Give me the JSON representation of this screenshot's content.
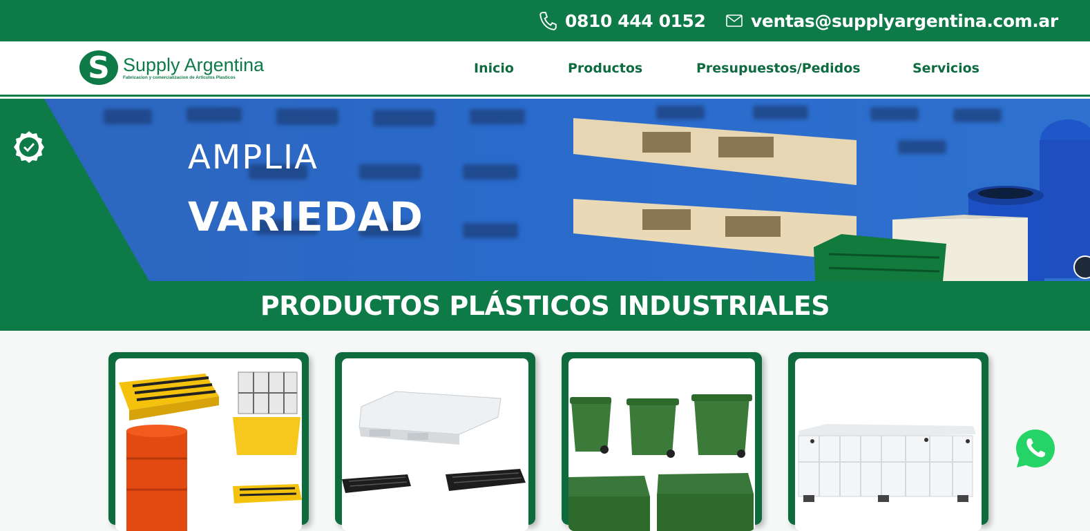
{
  "topbar": {
    "phone": "0810 444 0152",
    "email": "ventas@supplyargentina.com.ar",
    "phone_icon": "phone-icon",
    "email_icon": "envelope-icon"
  },
  "header": {
    "logo_name": "Supply Argentina",
    "logo_tagline": "Fabricacion y comercializacion de Articulos Plasticos",
    "nav": [
      "Inicio",
      "Productos",
      "Presupuestos/Pedidos",
      "Servicios"
    ]
  },
  "hero": {
    "line1": "AMPLIA",
    "line2": "VARIEDAD",
    "badge_icon": "check-badge-icon"
  },
  "section": {
    "title": "PRODUCTOS PLÁSTICOS INDUSTRIALES"
  },
  "products": [
    {
      "image": "spill-containment-products"
    },
    {
      "image": "plastic-pallets"
    },
    {
      "image": "waste-containers"
    },
    {
      "image": "plastic-bin-box"
    }
  ],
  "colors": {
    "brand_green": "#0d7a47",
    "nav_green": "#0d6b3e",
    "whatsapp_green": "#25d366"
  }
}
